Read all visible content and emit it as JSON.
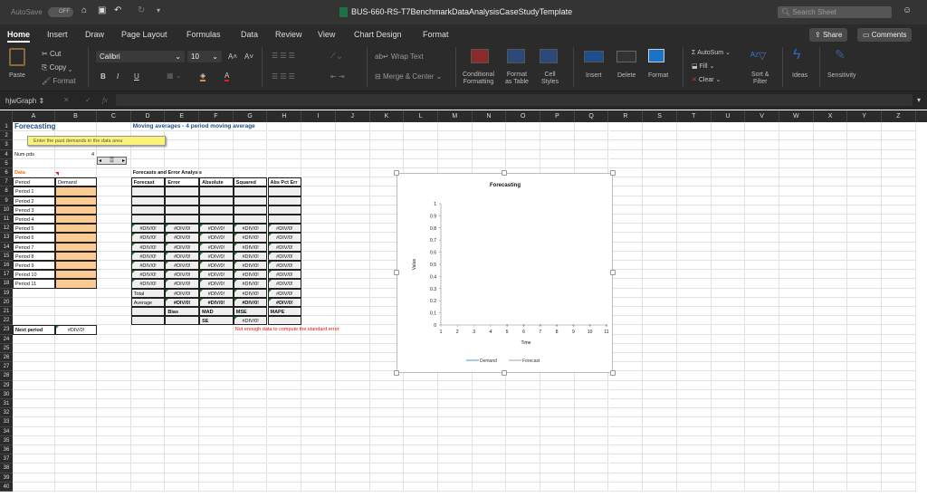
{
  "titlebar": {
    "autosave_label": "AutoSave",
    "autosave_state": "OFF",
    "doc_title": "BUS-660-RS-T7BenchmarkDataAnalysisCaseStudyTemplate",
    "search_placeholder": "Search Sheet"
  },
  "tabs": [
    "Home",
    "Insert",
    "Draw",
    "Page Layout",
    "Formulas",
    "Data",
    "Review",
    "View",
    "Chart Design",
    "Format"
  ],
  "share_label": "Share",
  "comments_label": "Comments",
  "ribbon": {
    "paste": "Paste",
    "cut": "Cut",
    "copy": "Copy",
    "format_painter": "Format",
    "font_name": "Calibri",
    "font_size": "10",
    "bold": "B",
    "italic": "I",
    "underline": "U",
    "wrap_text": "Wrap Text",
    "merge_center": "Merge & Center",
    "cond_fmt_1": "Conditional",
    "cond_fmt_2": "Formatting",
    "fmt_table_1": "Format",
    "fmt_table_2": "as Table",
    "cell_styles_1": "Cell",
    "cell_styles_2": "Styles",
    "insert": "Insert",
    "delete": "Delete",
    "format": "Format",
    "autosum": "AutoSum",
    "fill": "Fill",
    "clear": "Clear",
    "sort_1": "Sort &",
    "sort_2": "Filter",
    "ideas": "Ideas",
    "sensitivity": "Sensitivity"
  },
  "formula_bar": {
    "name_box": "hjwGraph",
    "fx": "fx",
    "value": ""
  },
  "columns": [
    "A",
    "B",
    "C",
    "D",
    "E",
    "F",
    "G",
    "H",
    "I",
    "J",
    "K",
    "L",
    "M",
    "N",
    "O",
    "P",
    "Q",
    "R",
    "S",
    "T",
    "U",
    "V",
    "W",
    "X",
    "Y",
    "Z"
  ],
  "row_count": 40,
  "comment": "Enter the past demands in the data area",
  "cells": {
    "A1": "Forecasting",
    "D1": "Moving averages -  4 period moving average",
    "A4": "Num pds",
    "B4": "4",
    "A6": "Data",
    "D6": "Forecasts and Error Analysis",
    "A7": "Period",
    "B7": "Demand",
    "D7": "Forecast",
    "E7": "Error",
    "F7": "Absolute",
    "G7": "Squared",
    "H7": "Abs Pct Err",
    "A8": "Period 1",
    "A9": "Period 2",
    "A10": "Period 3",
    "A11": "Period 4",
    "A12": "Period 5",
    "A13": "Period 6",
    "A14": "Period 7",
    "A15": "Period 8",
    "A16": "Period 9",
    "A17": "Period 10",
    "A18": "Period 11",
    "D12": "#DIV/0!",
    "E12": "#DIV/0!",
    "F12": "#DIV/0!",
    "G12": "#DIV/0!",
    "H12": "#DIV/0!",
    "D13": "#DIV/0!",
    "E13": "#DIV/0!",
    "F13": "#DIV/0!",
    "G13": "#DIV/0!",
    "H13": "#DIV/0!",
    "D14": "#DIV/0!",
    "E14": "#DIV/0!",
    "F14": "#DIV/0!",
    "G14": "#DIV/0!",
    "H14": "#DIV/0!",
    "D15": "#DIV/0!",
    "E15": "#DIV/0!",
    "F15": "#DIV/0!",
    "G15": "#DIV/0!",
    "H15": "#DIV/0!",
    "D16": "#DIV/0!",
    "E16": "#DIV/0!",
    "F16": "#DIV/0!",
    "G16": "#DIV/0!",
    "H16": "#DIV/0!",
    "D17": "#DIV/0!",
    "E17": "#DIV/0!",
    "F17": "#DIV/0!",
    "G17": "#DIV/0!",
    "H17": "#DIV/0!",
    "D18": "#DIV/0!",
    "E18": "#DIV/0!",
    "F18": "#DIV/0!",
    "G18": "#DIV/0!",
    "H18": "#DIV/0!",
    "D19": "Total",
    "E19": "#DIV/0!",
    "F19": "#DIV/0!",
    "G19": "#DIV/0!",
    "H19": "#DIV/0!",
    "D20": "Average",
    "E20": "#DIV/0!",
    "F20": "#DIV/0!",
    "G20": "#DIV/0!",
    "H20": "#DIV/0!",
    "E21": "Bias",
    "F21": "MAD",
    "G21": "MSE",
    "H21": "MAPE",
    "F22": "SE",
    "G22": "#DIV/0!",
    "A23": "Next period",
    "B23": "#DIV/0!",
    "G23": "Not enough data to compute the standard error"
  },
  "chart_data": {
    "type": "line",
    "title": "Forecasting",
    "xlabel": "Time",
    "ylabel": "Value",
    "x": [
      1,
      2,
      3,
      4,
      5,
      6,
      7,
      8,
      9,
      10,
      11
    ],
    "ylim": [
      0,
      1
    ],
    "yticks": [
      "0",
      "0.1",
      "0.2",
      "0.3",
      "0.4",
      "0.5",
      "0.6",
      "0.7",
      "0.8",
      "0.9",
      "1"
    ],
    "series": [
      {
        "name": "Demand",
        "color": "#4a90d9",
        "values": [
          null,
          null,
          null,
          null,
          null,
          null,
          null,
          null,
          null,
          null,
          null
        ]
      },
      {
        "name": "Forecast",
        "color": "#a5a5a5",
        "values": [
          null,
          null,
          null,
          null,
          0,
          0,
          0,
          0,
          0,
          0,
          0
        ]
      }
    ],
    "legend": "bottom"
  }
}
